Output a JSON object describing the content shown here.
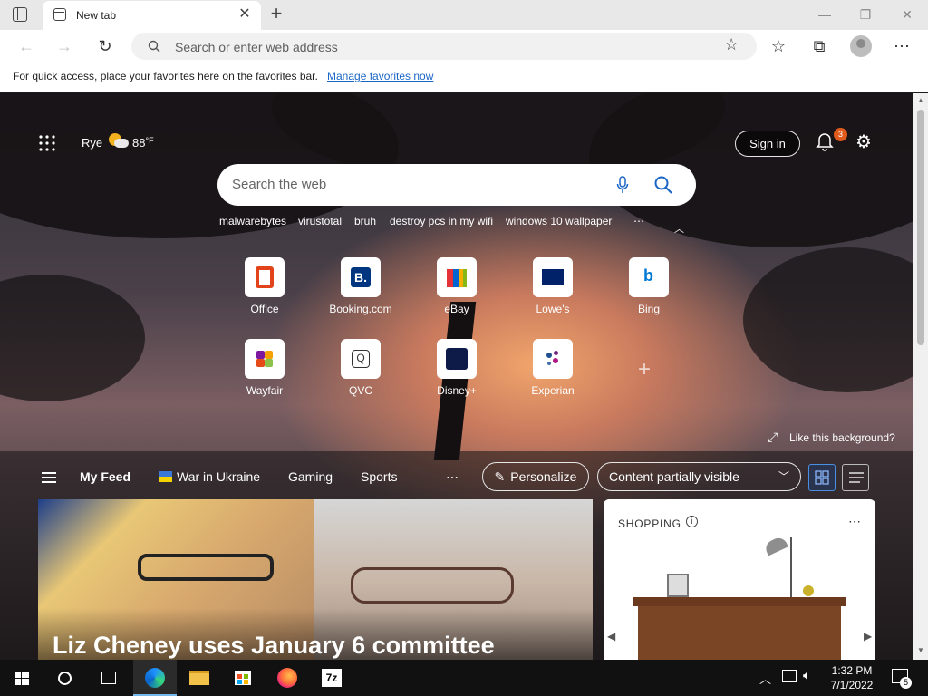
{
  "browser": {
    "tab_title": "New tab",
    "address_placeholder": "Search or enter web address",
    "favorites_message": "For quick access, place your favorites here on the favorites bar.",
    "manage_favorites_link": "Manage favorites now"
  },
  "header": {
    "location": "Rye",
    "temperature": "88",
    "temp_unit": "°F",
    "sign_in": "Sign in",
    "notification_count": "3"
  },
  "search": {
    "placeholder": "Search the web",
    "trending": [
      "malwarebytes",
      "virustotal",
      "bruh",
      "destroy pcs in my wifi",
      "windows 10 wallpaper"
    ]
  },
  "quick_links": [
    {
      "label": "Office",
      "icon": "office-icon"
    },
    {
      "label": "Booking.com",
      "icon": "booking-icon"
    },
    {
      "label": "eBay",
      "icon": "ebay-icon"
    },
    {
      "label": "Lowe's",
      "icon": "lowes-icon"
    },
    {
      "label": "Bing",
      "icon": "bing-icon"
    },
    {
      "label": "Wayfair",
      "icon": "wayfair-icon"
    },
    {
      "label": "QVC",
      "icon": "qvc-icon"
    },
    {
      "label": "Disney+",
      "icon": "disney-icon"
    },
    {
      "label": "Experian",
      "icon": "experian-icon"
    }
  ],
  "background_prompt": "Like this background?",
  "feed": {
    "tabs": [
      "My Feed",
      "War in Ukraine",
      "Gaming",
      "Sports"
    ],
    "personalize": "Personalize",
    "visibility": "Content partially visible",
    "headline": "Liz Cheney uses January 6 committee",
    "shopping_label": "SHOPPING"
  },
  "taskbar": {
    "time": "1:32 PM",
    "date": "7/1/2022",
    "notifications": "5"
  },
  "colors": {
    "accent": "#0078d4",
    "link": "#1a66c4",
    "badge": "#e05a1b"
  }
}
